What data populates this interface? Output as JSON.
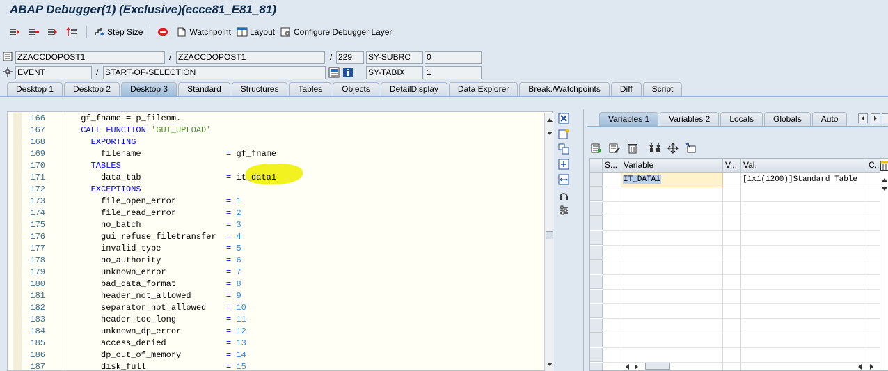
{
  "window": {
    "title": "ABAP Debugger(1)  (Exclusive)(ecce81_E81_81)"
  },
  "toolbar": {
    "buttons": [
      {
        "name": "step-into",
        "icon": "step-into-icon"
      },
      {
        "name": "execute",
        "icon": "execute-icon"
      },
      {
        "name": "return",
        "icon": "return-icon"
      },
      {
        "name": "continue",
        "icon": "continue-icon"
      }
    ],
    "step_size": "Step Size",
    "watchpoint": "Watchpoint",
    "layout": "Layout",
    "configure": "Configure Debugger Layer"
  },
  "fields": {
    "program": "ZZACCDOPOST1",
    "include": "ZZACCDOPOST1",
    "line": "229",
    "sy_subrc_label": "SY-SUBRC",
    "sy_subrc_value": "0",
    "event_type": "EVENT",
    "event_name": "START-OF-SELECTION",
    "sy_tabix_label": "SY-TABIX",
    "sy_tabix_value": "1",
    "slash1": "/",
    "slash2": "/",
    "slash3": "/",
    "slash4": "/"
  },
  "tabs": [
    "Desktop 1",
    "Desktop 2",
    "Desktop 3",
    "Standard",
    "Structures",
    "Tables",
    "Objects",
    "DetailDisplay",
    "Data Explorer",
    "Break./Watchpoints",
    "Diff",
    "Script"
  ],
  "active_tab": "Desktop 3",
  "code": [
    {
      "ln": "166",
      "ind": "      ",
      "parts": [
        [
          "t",
          "gf_fname = p_filenm."
        ]
      ]
    },
    {
      "ln": "167",
      "ind": "      ",
      "parts": [
        [
          "k",
          "CALL FUNCTION "
        ],
        [
          "s",
          "'GUI_UPLOAD'"
        ]
      ]
    },
    {
      "ln": "168",
      "ind": "        ",
      "parts": [
        [
          "k",
          "EXPORTING"
        ]
      ]
    },
    {
      "ln": "169",
      "ind": "          ",
      "parts": [
        [
          "t",
          "filename                 "
        ],
        [
          "e",
          "= "
        ],
        [
          "t",
          "gf_fname"
        ]
      ]
    },
    {
      "ln": "170",
      "ind": "        ",
      "parts": [
        [
          "k",
          "TABLES"
        ]
      ]
    },
    {
      "ln": "171",
      "ind": "          ",
      "parts": [
        [
          "t",
          "data_tab                 "
        ],
        [
          "e",
          "= "
        ],
        [
          "t",
          "it_data1"
        ]
      ]
    },
    {
      "ln": "172",
      "ind": "        ",
      "parts": [
        [
          "k",
          "EXCEPTIONS"
        ]
      ]
    },
    {
      "ln": "173",
      "ind": "          ",
      "parts": [
        [
          "t",
          "file_open_error          "
        ],
        [
          "e",
          "= "
        ],
        [
          "n",
          "1"
        ]
      ]
    },
    {
      "ln": "174",
      "ind": "          ",
      "parts": [
        [
          "t",
          "file_read_error          "
        ],
        [
          "e",
          "= "
        ],
        [
          "n",
          "2"
        ]
      ]
    },
    {
      "ln": "175",
      "ind": "          ",
      "parts": [
        [
          "t",
          "no_batch                 "
        ],
        [
          "e",
          "= "
        ],
        [
          "n",
          "3"
        ]
      ]
    },
    {
      "ln": "176",
      "ind": "          ",
      "parts": [
        [
          "t",
          "gui_refuse_filetransfer  "
        ],
        [
          "e",
          "= "
        ],
        [
          "n",
          "4"
        ]
      ]
    },
    {
      "ln": "177",
      "ind": "          ",
      "parts": [
        [
          "t",
          "invalid_type             "
        ],
        [
          "e",
          "= "
        ],
        [
          "n",
          "5"
        ]
      ]
    },
    {
      "ln": "178",
      "ind": "          ",
      "parts": [
        [
          "t",
          "no_authority             "
        ],
        [
          "e",
          "= "
        ],
        [
          "n",
          "6"
        ]
      ]
    },
    {
      "ln": "179",
      "ind": "          ",
      "parts": [
        [
          "t",
          "unknown_error            "
        ],
        [
          "e",
          "= "
        ],
        [
          "n",
          "7"
        ]
      ]
    },
    {
      "ln": "180",
      "ind": "          ",
      "parts": [
        [
          "t",
          "bad_data_format          "
        ],
        [
          "e",
          "= "
        ],
        [
          "n",
          "8"
        ]
      ]
    },
    {
      "ln": "181",
      "ind": "          ",
      "parts": [
        [
          "t",
          "header_not_allowed       "
        ],
        [
          "e",
          "= "
        ],
        [
          "n",
          "9"
        ]
      ]
    },
    {
      "ln": "182",
      "ind": "          ",
      "parts": [
        [
          "t",
          "separator_not_allowed    "
        ],
        [
          "e",
          "= "
        ],
        [
          "n",
          "10"
        ]
      ]
    },
    {
      "ln": "183",
      "ind": "          ",
      "parts": [
        [
          "t",
          "header_too_long          "
        ],
        [
          "e",
          "= "
        ],
        [
          "n",
          "11"
        ]
      ]
    },
    {
      "ln": "184",
      "ind": "          ",
      "parts": [
        [
          "t",
          "unknown_dp_error         "
        ],
        [
          "e",
          "= "
        ],
        [
          "n",
          "12"
        ]
      ]
    },
    {
      "ln": "185",
      "ind": "          ",
      "parts": [
        [
          "t",
          "access_denied            "
        ],
        [
          "e",
          "= "
        ],
        [
          "n",
          "13"
        ]
      ]
    },
    {
      "ln": "186",
      "ind": "          ",
      "parts": [
        [
          "t",
          "dp_out_of_memory         "
        ],
        [
          "e",
          "= "
        ],
        [
          "n",
          "14"
        ]
      ]
    },
    {
      "ln": "187",
      "ind": "          ",
      "parts": [
        [
          "t",
          "disk_full                "
        ],
        [
          "e",
          "= "
        ],
        [
          "n",
          "15"
        ]
      ]
    }
  ],
  "variables": {
    "tabs": [
      "Variables 1",
      "Variables 2",
      "Locals",
      "Globals",
      "Auto"
    ],
    "active_tab": "Variables 1",
    "columns": [
      "S...",
      "Variable",
      "V...",
      "Val.",
      "C..."
    ],
    "row_variable": "IT_DATA1",
    "row_value": "[1x1(1200)]Standard Table"
  },
  "colors": {
    "keyword": "#0000ff",
    "string": "#4d8a2a",
    "number": "#2f8ad8",
    "highlight": "#f2f221",
    "accent": "#8fb0d2"
  }
}
